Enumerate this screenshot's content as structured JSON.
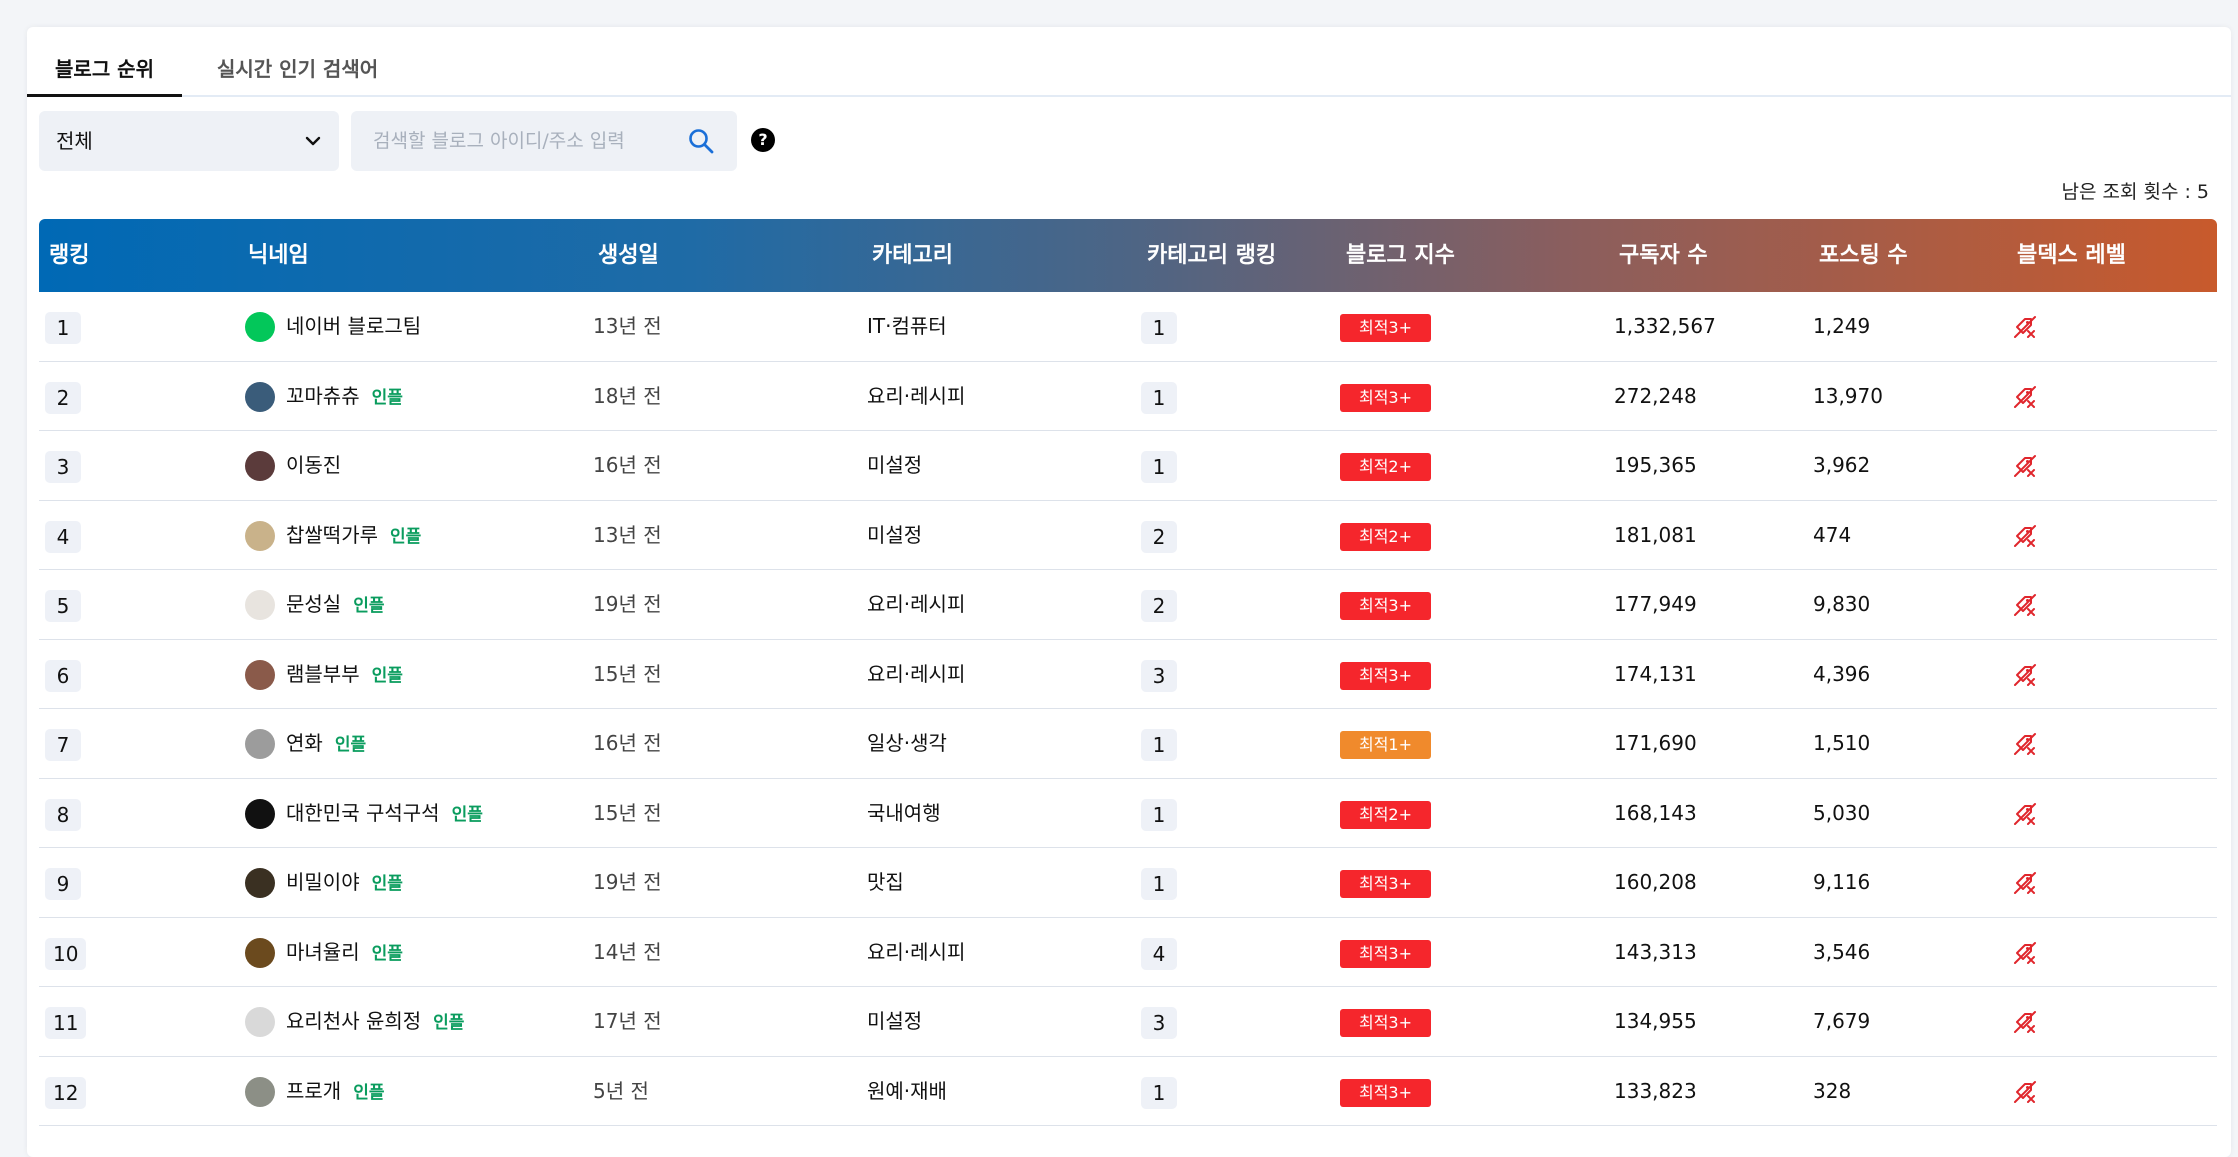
{
  "tabs": [
    {
      "label": "블로그 순위",
      "active": true
    },
    {
      "label": "실시간 인기 검색어",
      "active": false
    }
  ],
  "filter": {
    "selected": "전체"
  },
  "search": {
    "placeholder": "검색할 블로그 아이디/주소 입력"
  },
  "help_label": "?",
  "remaining": "남은 조회 횟수 : 5",
  "columns": [
    "랭킹",
    "닉네임",
    "생성일",
    "카테고리",
    "카테고리 랭킹",
    "블로그 지수",
    "구독자 수",
    "포스팅 수",
    "블덱스 레벨"
  ],
  "influencer_label": "인플",
  "colors": {
    "badge_red": "#f5262c",
    "badge_orange": "#f08a2c",
    "influencer": "#0a9c5e",
    "accent_blue": "#1a6fd8"
  },
  "rows": [
    {
      "rank": "1",
      "nickname": "네이버 블로그팀",
      "influencer": false,
      "created": "13년 전",
      "category": "IT·컴퓨터",
      "cat_rank": "1",
      "index": "최적3+",
      "index_color": "red",
      "subscribers": "1,332,567",
      "posts": "1,249"
    },
    {
      "rank": "2",
      "nickname": "꼬마츄츄",
      "influencer": true,
      "created": "18년 전",
      "category": "요리·레시피",
      "cat_rank": "1",
      "index": "최적3+",
      "index_color": "red",
      "subscribers": "272,248",
      "posts": "13,970"
    },
    {
      "rank": "3",
      "nickname": "이동진",
      "influencer": false,
      "created": "16년 전",
      "category": "미설정",
      "cat_rank": "1",
      "index": "최적2+",
      "index_color": "red",
      "subscribers": "195,365",
      "posts": "3,962"
    },
    {
      "rank": "4",
      "nickname": "찹쌀떡가루",
      "influencer": true,
      "created": "13년 전",
      "category": "미설정",
      "cat_rank": "2",
      "index": "최적2+",
      "index_color": "red",
      "subscribers": "181,081",
      "posts": "474"
    },
    {
      "rank": "5",
      "nickname": "문성실",
      "influencer": true,
      "created": "19년 전",
      "category": "요리·레시피",
      "cat_rank": "2",
      "index": "최적3+",
      "index_color": "red",
      "subscribers": "177,949",
      "posts": "9,830"
    },
    {
      "rank": "6",
      "nickname": "램블부부",
      "influencer": true,
      "created": "15년 전",
      "category": "요리·레시피",
      "cat_rank": "3",
      "index": "최적3+",
      "index_color": "red",
      "subscribers": "174,131",
      "posts": "4,396"
    },
    {
      "rank": "7",
      "nickname": "연화",
      "influencer": true,
      "created": "16년 전",
      "category": "일상·생각",
      "cat_rank": "1",
      "index": "최적1+",
      "index_color": "orange",
      "subscribers": "171,690",
      "posts": "1,510"
    },
    {
      "rank": "8",
      "nickname": "대한민국 구석구석",
      "influencer": true,
      "created": "15년 전",
      "category": "국내여행",
      "cat_rank": "1",
      "index": "최적2+",
      "index_color": "red",
      "subscribers": "168,143",
      "posts": "5,030"
    },
    {
      "rank": "9",
      "nickname": "비밀이야",
      "influencer": true,
      "created": "19년 전",
      "category": "맛집",
      "cat_rank": "1",
      "index": "최적3+",
      "index_color": "red",
      "subscribers": "160,208",
      "posts": "9,116"
    },
    {
      "rank": "10",
      "nickname": "마녀율리",
      "influencer": true,
      "created": "14년 전",
      "category": "요리·레시피",
      "cat_rank": "4",
      "index": "최적3+",
      "index_color": "red",
      "subscribers": "143,313",
      "posts": "3,546"
    },
    {
      "rank": "11",
      "nickname": "요리천사 윤희정",
      "influencer": true,
      "created": "17년 전",
      "category": "미설정",
      "cat_rank": "3",
      "index": "최적3+",
      "index_color": "red",
      "subscribers": "134,955",
      "posts": "7,679"
    },
    {
      "rank": "12",
      "nickname": "프로개",
      "influencer": true,
      "created": "5년 전",
      "category": "원예·재배",
      "cat_rank": "1",
      "index": "최적3+",
      "index_color": "red",
      "subscribers": "133,823",
      "posts": "328"
    }
  ]
}
